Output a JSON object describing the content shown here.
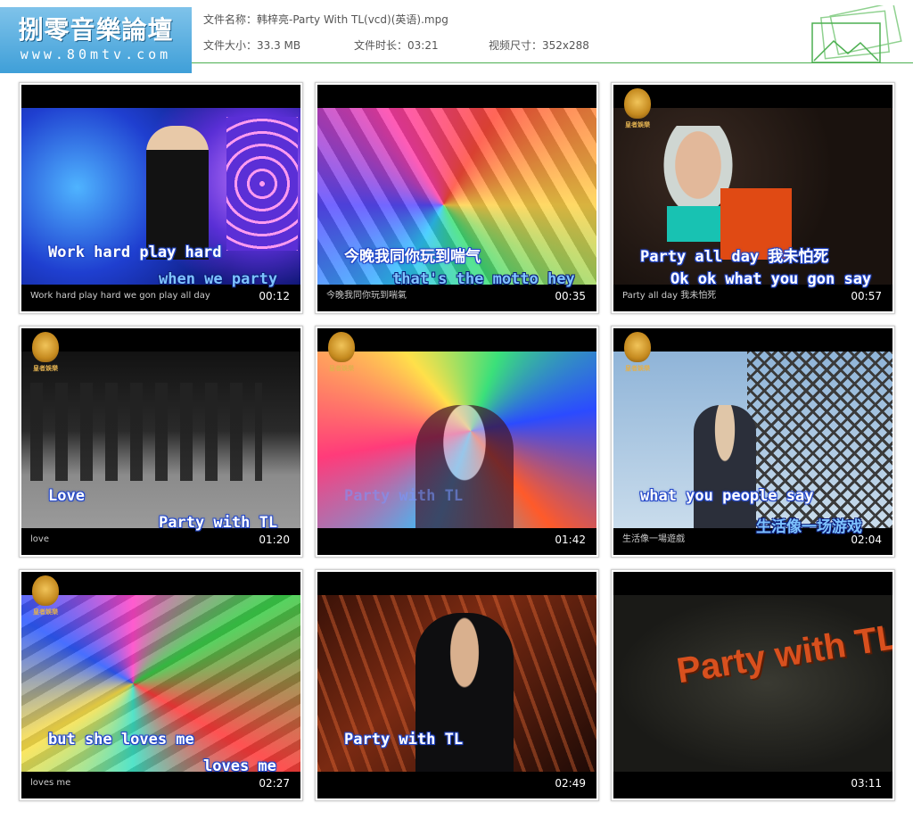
{
  "header": {
    "logo_title": "捌零音樂論壇",
    "logo_sub": "www.80mtv.com",
    "filename_label": "文件名称：",
    "filename": "韩梓亮-Party With TL(vcd)(英语).mpg",
    "size_label": "文件大小：",
    "size": "33.3 MB",
    "duration_label": "文件时长：",
    "duration": "03:21",
    "dimensions_label": "视频尺寸：",
    "dimensions": "352x288"
  },
  "thumbnails": [
    {
      "lyric1": "Work hard play hard",
      "lyric2": "when we party",
      "caption": "Work hard play hard we gon play all day",
      "time": "00:12"
    },
    {
      "lyric1": "今晚我同你玩到喘气",
      "lyric2": "that's the motto hey",
      "caption": "今晚我同你玩到喘氣",
      "time": "00:35"
    },
    {
      "lyric1": "Party all day 我未怕死",
      "lyric2": "Ok ok what you gon say",
      "caption": "Party all day 我未怕死",
      "time": "00:57",
      "badge": "皇者娛樂"
    },
    {
      "lyric1": "Love",
      "lyric2": "Party with TL",
      "caption": "love",
      "time": "01:20",
      "badge": "皇者娛樂"
    },
    {
      "lyric1": "Party with TL",
      "lyric2": "",
      "caption": "",
      "time": "01:42",
      "badge": "皇者娛樂"
    },
    {
      "lyric1": "what you people say",
      "lyric2": "生活像一场游戏",
      "caption": "生活像一場遊戲",
      "time": "02:04",
      "badge": "皇者娛樂"
    },
    {
      "lyric1": "but she loves me",
      "lyric2": "loves me",
      "caption": "loves me",
      "time": "02:27",
      "badge": "皇者娛樂"
    },
    {
      "lyric1": "Party with TL",
      "lyric2": "",
      "caption": "",
      "time": "02:49"
    },
    {
      "lyric1": "",
      "lyric2": "",
      "caption": "",
      "time": "03:11",
      "title_card": "Party with TL"
    }
  ],
  "colors": {
    "accent_line": "#4caf50",
    "logo_bg": "#3f9fd8"
  }
}
